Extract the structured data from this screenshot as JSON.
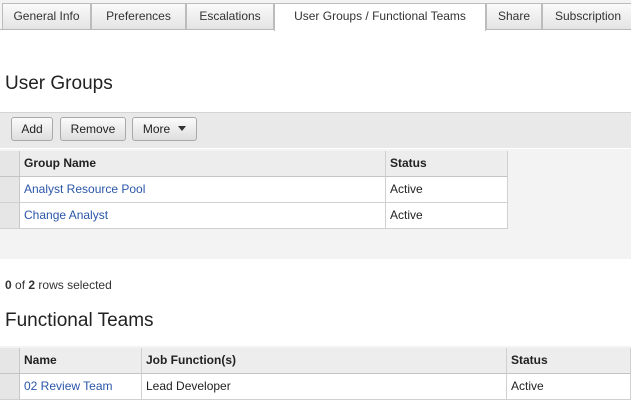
{
  "tabs": [
    {
      "label": "General Info",
      "active": false
    },
    {
      "label": "Preferences",
      "active": false
    },
    {
      "label": "Escalations",
      "active": false
    },
    {
      "label": "User Groups / Functional Teams",
      "active": true
    },
    {
      "label": "Share",
      "active": false
    },
    {
      "label": "Subscription",
      "active": false
    }
  ],
  "user_groups": {
    "title": "User Groups",
    "toolbar": {
      "add_label": "Add",
      "remove_label": "Remove",
      "more_label": "More"
    },
    "columns": [
      "Group Name",
      "Status"
    ],
    "rows": [
      {
        "group_name": "Analyst Resource Pool",
        "status": "Active"
      },
      {
        "group_name": "Change Analyst",
        "status": "Active"
      }
    ],
    "selection": {
      "selected": "0",
      "of_text": " of ",
      "total": "2",
      "suffix": " rows selected"
    }
  },
  "functional_teams": {
    "title": "Functional Teams",
    "columns": [
      "Name",
      "Job Function(s)",
      "Status"
    ],
    "rows": [
      {
        "name": "02 Review Team",
        "job_function": "Lead Developer",
        "status": "Active"
      }
    ]
  },
  "colors": {
    "link": "#2a56a8",
    "toolbar_bg": "#e9e9e9",
    "grid_bg": "#f3f3f3"
  },
  "icons": {
    "more_dropdown": "caret-down-icon"
  }
}
